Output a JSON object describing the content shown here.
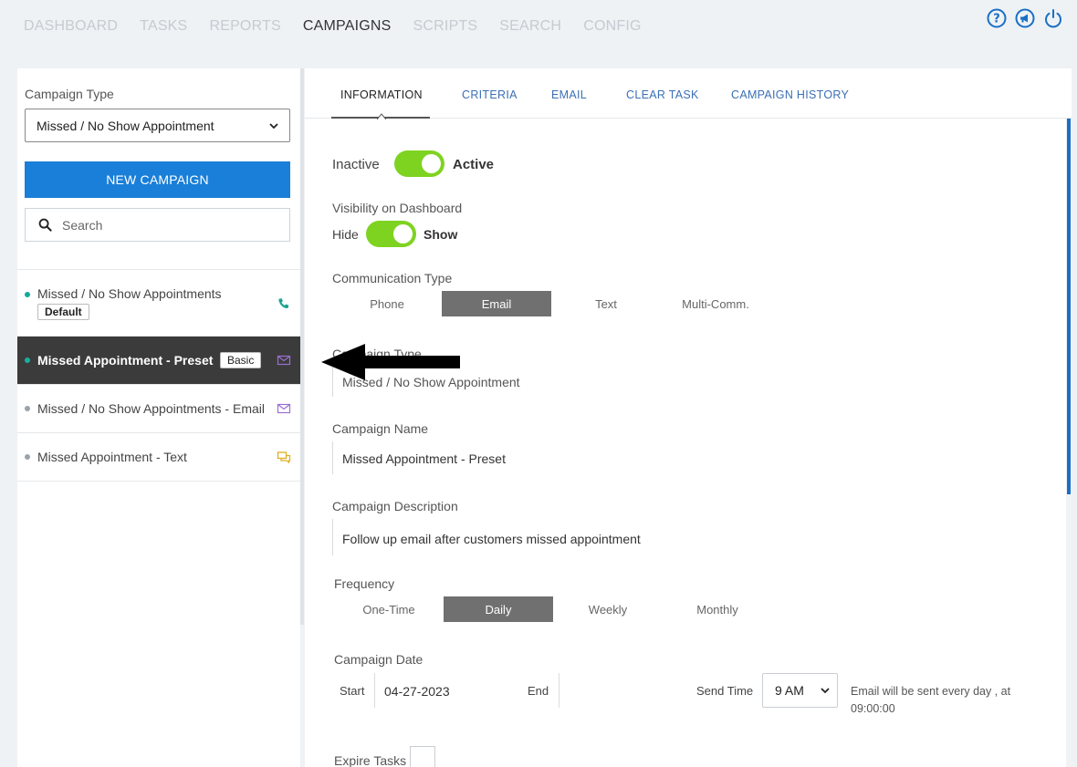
{
  "topnav": {
    "items": [
      {
        "label": "DASHBOARD"
      },
      {
        "label": "TASKS"
      },
      {
        "label": "REPORTS"
      },
      {
        "label": "CAMPAIGNS"
      },
      {
        "label": "SCRIPTS"
      },
      {
        "label": "SEARCH"
      },
      {
        "label": "CONFIG"
      }
    ],
    "active": "CAMPAIGNS",
    "icons": [
      "help-icon",
      "announcement-icon",
      "power-icon"
    ]
  },
  "sidebar": {
    "campaign_type_label": "Campaign Type",
    "campaign_type_value": "Missed / No Show Appointment",
    "new_campaign_label": "NEW CAMPAIGN",
    "search_placeholder": "Search",
    "campaigns": [
      {
        "name": "Missed / No Show Appointments",
        "badge": "Default",
        "icon": "phone-icon",
        "status_color": "#15a89a"
      },
      {
        "name": "Missed Appointment - Preset",
        "badge": "Basic",
        "icon": "email-icon",
        "status_color": "#17b0a0",
        "selected": true
      },
      {
        "name": "Missed / No Show Appointments - Email",
        "badge": "",
        "icon": "email-icon",
        "status_color": "#9aa3ad"
      },
      {
        "name": "Missed Appointment - Text",
        "badge": "",
        "icon": "chat-icon",
        "status_color": "#9aa3ad"
      }
    ]
  },
  "tabs": [
    {
      "label": "INFORMATION"
    },
    {
      "label": "CRITERIA"
    },
    {
      "label": "EMAIL"
    },
    {
      "label": "CLEAR TASK"
    },
    {
      "label": "CAMPAIGN HISTORY"
    }
  ],
  "form": {
    "status_off_label": "Inactive",
    "status_on_label": "Active",
    "visibility_label": "Visibility on Dashboard",
    "visibility_off_label": "Hide",
    "visibility_on_label": "Show",
    "communication_type_label": "Communication Type",
    "communication_types": [
      "Phone",
      "Email",
      "Text",
      "Multi-Comm."
    ],
    "communication_selected": "Email",
    "campaign_type_label": "Campaign Type",
    "campaign_type_value": "Missed / No Show Appointment",
    "campaign_name_label": "Campaign Name",
    "campaign_name_value": "Missed Appointment - Preset",
    "campaign_description_label": "Campaign Description",
    "campaign_description_value": "Follow up email after customers missed appointment",
    "frequency_label": "Frequency",
    "frequencies": [
      "One-Time",
      "Daily",
      "Weekly",
      "Monthly"
    ],
    "frequency_selected": "Daily",
    "campaign_date_label": "Campaign Date",
    "start_label": "Start",
    "start_value": "04-27-2023",
    "end_label": "End",
    "send_time_label": "Send Time",
    "send_time_value": "9 AM",
    "send_note": "Email will be sent every day , at 09:00:00",
    "expire_tasks_label": "Expire Tasks"
  },
  "colors": {
    "accent_blue": "#1a7fd8",
    "toggle_green": "#7ed321",
    "selected_row": "#3b3b3b"
  }
}
